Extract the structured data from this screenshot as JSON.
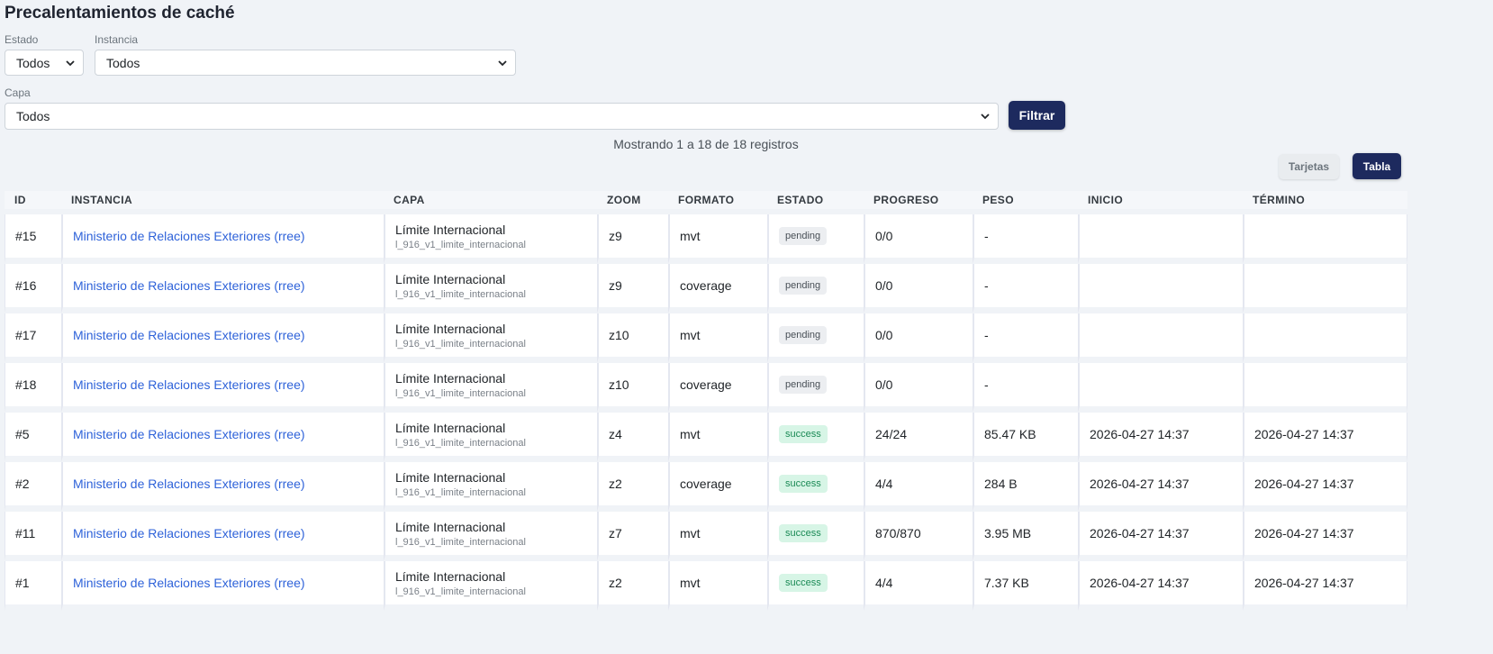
{
  "page": {
    "title": "Precalentamientos de caché"
  },
  "filters": {
    "estado": {
      "label": "Estado",
      "value": "Todos"
    },
    "instancia": {
      "label": "Instancia",
      "value": "Todos"
    },
    "capa": {
      "label": "Capa",
      "value": "Todos"
    },
    "submit_label": "Filtrar"
  },
  "records_info": "Mostrando 1 a 18 de 18 registros",
  "view_toggle": {
    "cards_label": "Tarjetas",
    "table_label": "Tabla"
  },
  "table": {
    "headers": [
      "ID",
      "INSTANCIA",
      "CAPA",
      "ZOOM",
      "FORMATO",
      "ESTADO",
      "PROGRESO",
      "PESO",
      "INICIO",
      "TÉRMINO"
    ],
    "rows": [
      {
        "id": "#15",
        "instance": "Ministerio de Relaciones Exteriores (rree)",
        "layer_name": "Límite Internacional",
        "layer_id": "l_916_v1_limite_internacional",
        "zoom": "z9",
        "format": "mvt",
        "status": "pending",
        "progress": "0/0",
        "size": "-",
        "start": "",
        "end": ""
      },
      {
        "id": "#16",
        "instance": "Ministerio de Relaciones Exteriores (rree)",
        "layer_name": "Límite Internacional",
        "layer_id": "l_916_v1_limite_internacional",
        "zoom": "z9",
        "format": "coverage",
        "status": "pending",
        "progress": "0/0",
        "size": "-",
        "start": "",
        "end": ""
      },
      {
        "id": "#17",
        "instance": "Ministerio de Relaciones Exteriores (rree)",
        "layer_name": "Límite Internacional",
        "layer_id": "l_916_v1_limite_internacional",
        "zoom": "z10",
        "format": "mvt",
        "status": "pending",
        "progress": "0/0",
        "size": "-",
        "start": "",
        "end": ""
      },
      {
        "id": "#18",
        "instance": "Ministerio de Relaciones Exteriores (rree)",
        "layer_name": "Límite Internacional",
        "layer_id": "l_916_v1_limite_internacional",
        "zoom": "z10",
        "format": "coverage",
        "status": "pending",
        "progress": "0/0",
        "size": "-",
        "start": "",
        "end": ""
      },
      {
        "id": "#5",
        "instance": "Ministerio de Relaciones Exteriores (rree)",
        "layer_name": "Límite Internacional",
        "layer_id": "l_916_v1_limite_internacional",
        "zoom": "z4",
        "format": "mvt",
        "status": "success",
        "progress": "24/24",
        "size": "85.47 KB",
        "start": "2026-04-27 14:37",
        "end": "2026-04-27 14:37"
      },
      {
        "id": "#2",
        "instance": "Ministerio de Relaciones Exteriores (rree)",
        "layer_name": "Límite Internacional",
        "layer_id": "l_916_v1_limite_internacional",
        "zoom": "z2",
        "format": "coverage",
        "status": "success",
        "progress": "4/4",
        "size": "284 B",
        "start": "2026-04-27 14:37",
        "end": "2026-04-27 14:37"
      },
      {
        "id": "#11",
        "instance": "Ministerio de Relaciones Exteriores (rree)",
        "layer_name": "Límite Internacional",
        "layer_id": "l_916_v1_limite_internacional",
        "zoom": "z7",
        "format": "mvt",
        "status": "success",
        "progress": "870/870",
        "size": "3.95 MB",
        "start": "2026-04-27 14:37",
        "end": "2026-04-27 14:37"
      },
      {
        "id": "#1",
        "instance": "Ministerio de Relaciones Exteriores (rree)",
        "layer_name": "Límite Internacional",
        "layer_id": "l_916_v1_limite_internacional",
        "zoom": "z2",
        "format": "mvt",
        "status": "success",
        "progress": "4/4",
        "size": "7.37 KB",
        "start": "2026-04-27 14:37",
        "end": "2026-04-27 14:37"
      }
    ]
  },
  "colors": {
    "primary": "#1d2a5e",
    "link": "#2e62d9",
    "pending_bg": "#eceef1",
    "success_bg": "#d7f5e6",
    "success_text": "#1a8a55"
  }
}
